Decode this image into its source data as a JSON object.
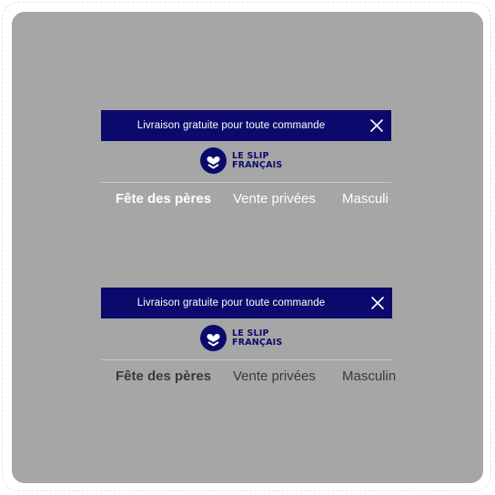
{
  "colors": {
    "canvas": "#a6a6a6",
    "banner": "#0b0a6c",
    "logo": "#0b0a6c",
    "nav_light": "#ffffff",
    "nav_dark": "#3a3a3a"
  },
  "variants": [
    {
      "banner": {
        "text": "Livraison gratuite pour toute commande",
        "close_icon": "close-icon"
      },
      "logo": {
        "line1": "LE SLIP",
        "line2": "FRANÇAIS",
        "icon": "heart-shield-icon"
      },
      "nav": {
        "items": [
          "Fête des pères",
          "Vente privées",
          "Masculi"
        ]
      }
    },
    {
      "banner": {
        "text": "Livraison gratuite pour toute commande",
        "close_icon": "close-icon"
      },
      "logo": {
        "line1": "LE SLIP",
        "line2": "FRANÇAIS",
        "icon": "heart-shield-icon"
      },
      "nav": {
        "items": [
          "Fête des pères",
          "Vente privées",
          "Masculin"
        ]
      }
    }
  ]
}
